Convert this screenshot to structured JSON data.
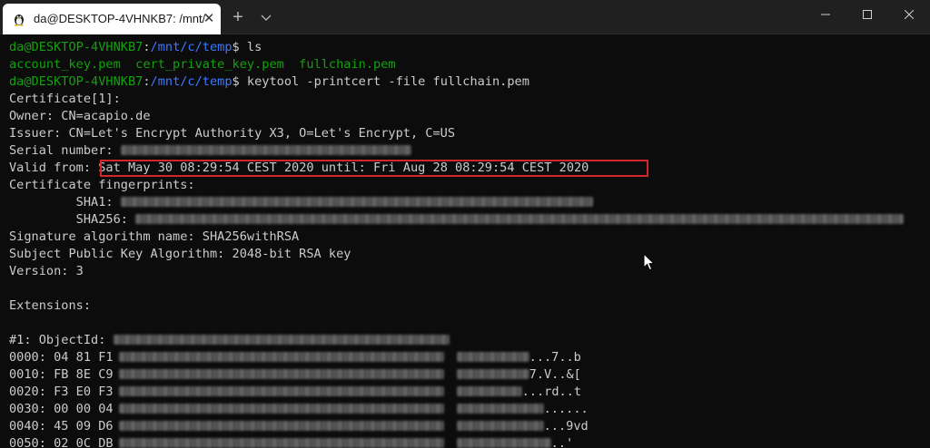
{
  "window": {
    "tab_title": "da@DESKTOP-4VHNKB7: /mnt/",
    "tab_icon": "linux-penguin-icon",
    "new_tab_label": "+",
    "close_tab_label": "✕"
  },
  "colors": {
    "prompt_user": "#13a10e",
    "prompt_path": "#3b78ff",
    "text": "#cccccc",
    "background": "#0c0c0c",
    "highlight": "#d2262b"
  },
  "terminal": {
    "prompt_user": "da@DESKTOP-4VHNKB7",
    "prompt_sep": ":",
    "prompt_path": "/mnt/c/temp",
    "prompt_end": "$ ",
    "cmd1": "ls",
    "files": "account_key.pem  cert_private_key.pem  fullchain.pem",
    "cmd2": "keytool -printcert -file fullchain.pem",
    "cert_header": "Certificate[1]:",
    "owner": "Owner: CN=acapio.de",
    "issuer": "Issuer: CN=Let's Encrypt Authority X3, O=Let's Encrypt, C=US",
    "serial_label": "Serial number: ",
    "valid_label": "Valid from: ",
    "valid_value": "Sat May 30 08:29:54 CEST 2020 until: Fri Aug 28 08:29:54 CEST 2020",
    "fingerprints_label": "Certificate fingerprints:",
    "sha1_label": "         SHA1: ",
    "sha256_label": "         SHA256: ",
    "sig_alg": "Signature algorithm name: SHA256withRSA",
    "pubkey_alg": "Subject Public Key Algorithm: 2048-bit RSA key",
    "version": "Version: 3",
    "extensions": "Extensions:",
    "objectid_label": "#1: ObjectId: ",
    "hex_rows": [
      {
        "prefix": "0000: 04 81 F1",
        "suffix": "...7..b"
      },
      {
        "prefix": "0010: FB 8E C9",
        "suffix": "7.V..&["
      },
      {
        "prefix": "0020: F3 E0 F3",
        "suffix": "...rd..t"
      },
      {
        "prefix": "0030: 00 00 04",
        "suffix": "......"
      },
      {
        "prefix": "0040: 45 09 D6",
        "suffix": "...9vd"
      },
      {
        "prefix": "0050: 02 0C DB",
        "suffix": "..'"
      }
    ]
  }
}
